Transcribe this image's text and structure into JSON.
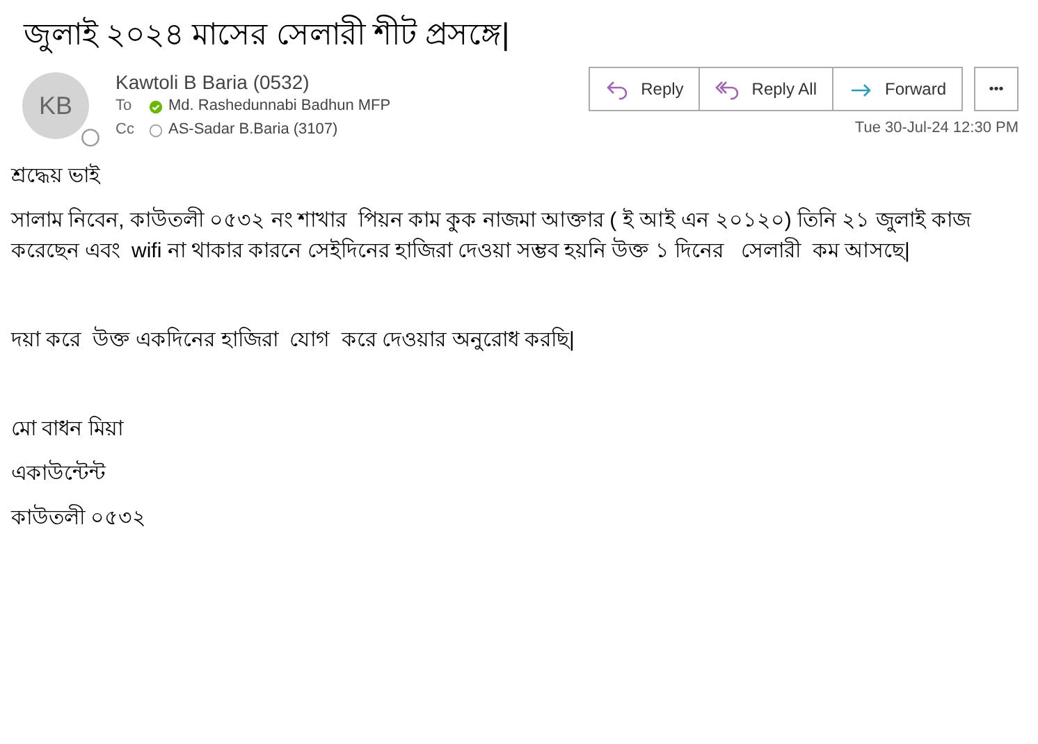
{
  "subject": "জুলাই ২০২৪ মাসের সেলারী শীট প্রসঙ্গে|",
  "sender": {
    "initials": "KB",
    "name": "Kawtoli B Baria (0532)",
    "available": false
  },
  "recipients": [
    {
      "label": "To",
      "name": "Md. Rashedunnabi Badhun MFP",
      "available": true
    },
    {
      "label": "Cc",
      "name": "AS-Sadar B.Baria (3107)",
      "available": false
    }
  ],
  "actions": [
    {
      "kind": "reply",
      "label": "Reply"
    },
    {
      "kind": "reply_all",
      "label": "Reply All"
    },
    {
      "kind": "forward",
      "label": "Forward"
    }
  ],
  "more_button": "•••",
  "timestamp": "Tue 30-Jul-24 12:30 PM",
  "body": [
    {
      "kind": "line",
      "text": "শ্রদ্ধেয় ভাই"
    },
    {
      "kind": "paragraph",
      "text": "সালাম নিবেন, কাউতলী ০৫৩২ নং শাখার  পিয়ন কাম কুক নাজমা আক্তার ( ই আই এন ২০১২০) তিনি ২১ জুলাই কাজ করেছেন এবং  wifi না থাকার কারনে সেইদিনের হাজিরা দেওয়া সম্ভব হয়নি উক্ত ১ দিনের   সেলারী  কম আসছে|"
    },
    {
      "kind": "gap"
    },
    {
      "kind": "line",
      "text": "দয়া করে  উক্ত একদিনের হাজিরা  যোগ  করে দেওয়ার অনুরোধ করছি|"
    },
    {
      "kind": "gap"
    },
    {
      "kind": "line",
      "text": "মো বাধন মিয়া"
    },
    {
      "kind": "line",
      "text": "একাউন্টেন্ট"
    },
    {
      "kind": "line",
      "text": "কাউতলী ০৫৩২"
    }
  ]
}
